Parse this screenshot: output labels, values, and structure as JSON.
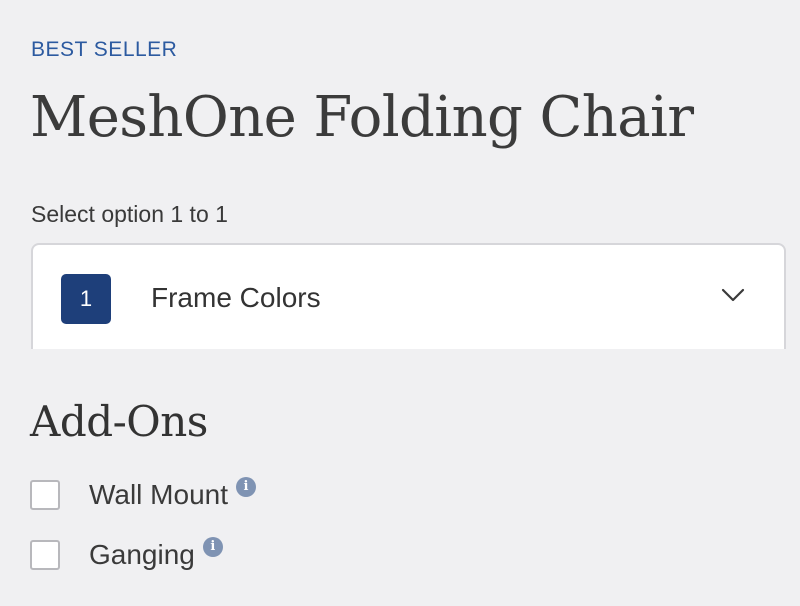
{
  "product": {
    "badge": "BEST SELLER",
    "title": "MeshOne Folding Chair"
  },
  "options": {
    "hint": "Select option 1 to 1",
    "select": {
      "number": "1",
      "label": "Frame Colors",
      "icon": "chevron-down-icon"
    }
  },
  "addons": {
    "heading": "Add-Ons",
    "items": [
      {
        "label": "Wall Mount",
        "checked": false,
        "info_glyph": "i"
      },
      {
        "label": "Ganging",
        "checked": false,
        "info_glyph": "i"
      }
    ]
  },
  "colors": {
    "background": "#f0f0f2",
    "accent": "#2c5aa0",
    "number_badge": "#1e3f7a",
    "info_icon": "#7f93b3"
  }
}
